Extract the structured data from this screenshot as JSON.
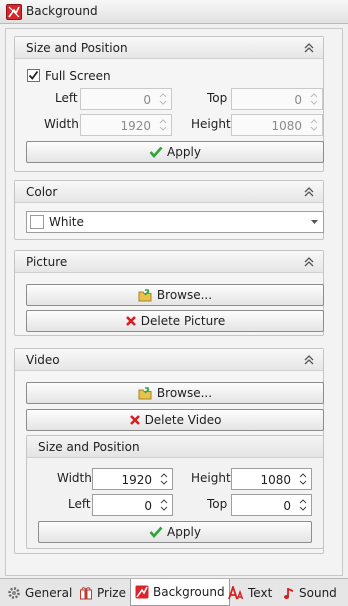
{
  "window": {
    "title": "Background",
    "icon": "app-logo-icon"
  },
  "size_position": {
    "header": "Size and Position",
    "full_screen_label": "Full Screen",
    "full_screen_checked": true,
    "left_label": "Left",
    "left_value": "0",
    "top_label": "Top",
    "top_value": "0",
    "width_label": "Width",
    "width_value": "1920",
    "height_label": "Height",
    "height_value": "1080",
    "apply_label": "Apply"
  },
  "color": {
    "header": "Color",
    "selected": "White",
    "swatch": "#ffffff"
  },
  "picture": {
    "header": "Picture",
    "browse_label": "Browse...",
    "delete_label": "Delete Picture"
  },
  "video": {
    "header": "Video",
    "browse_label": "Browse...",
    "delete_label": "Delete Video",
    "size_position": {
      "header": "Size and Position",
      "width_label": "Width",
      "width_value": "1920",
      "height_label": "Height",
      "height_value": "1080",
      "left_label": "Left",
      "left_value": "0",
      "top_label": "Top",
      "top_value": "0",
      "apply_label": "Apply"
    }
  },
  "tabs": [
    {
      "label": "General",
      "icon": "gear-icon"
    },
    {
      "label": "Prize",
      "icon": "gift-icon"
    },
    {
      "label": "Background",
      "icon": "background-icon",
      "active": true
    },
    {
      "label": "Text",
      "icon": "text-icon"
    },
    {
      "label": "Sound",
      "icon": "music-note-icon"
    }
  ],
  "colors": {
    "accent_red": "#d8262b",
    "check_green": "#2ea43a",
    "delete_red": "#d42020"
  }
}
